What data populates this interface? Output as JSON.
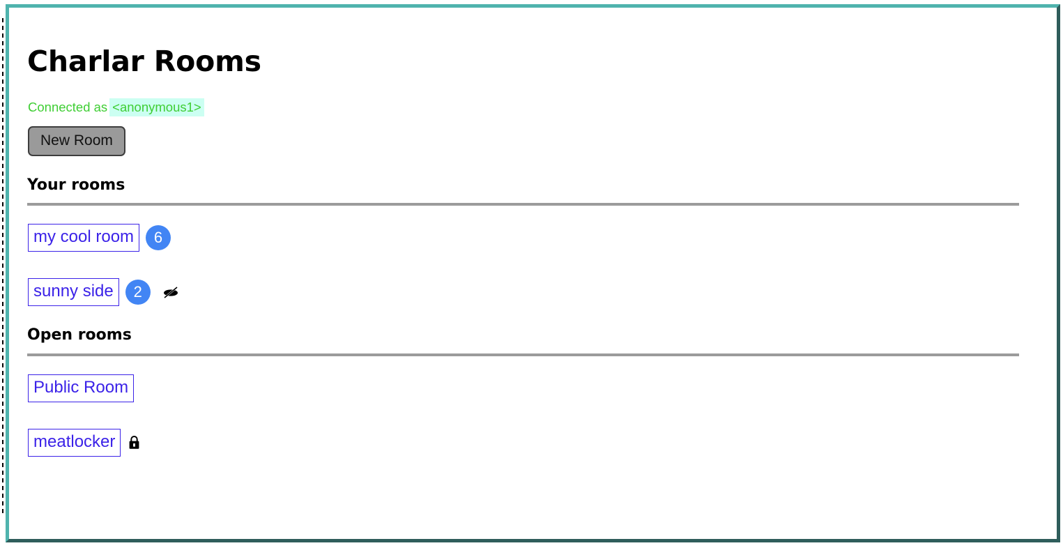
{
  "window": {
    "frame_accent_light": "#4fb3ad",
    "frame_accent_dark": "#2f5d5b"
  },
  "header": {
    "title": "Charlar Rooms",
    "connection_prefix": "Connected as",
    "username": "<anonymous1>",
    "status_color": "#3fce34",
    "username_highlight": "#ccfff2"
  },
  "toolbar": {
    "new_room_label": "New Room"
  },
  "sections": [
    {
      "heading": "Your rooms",
      "rooms": [
        {
          "name": "my cool room",
          "badge": "6",
          "icon": null
        },
        {
          "name": "sunny side",
          "badge": "2",
          "icon": "eye-slash-icon"
        }
      ]
    },
    {
      "heading": "Open rooms",
      "rooms": [
        {
          "name": "Public Room",
          "badge": null,
          "icon": null
        },
        {
          "name": "meatlocker",
          "badge": null,
          "icon": "lock-icon"
        }
      ]
    }
  ],
  "colors": {
    "link": "#3b22e8",
    "badge": "#4285f4",
    "button_face": "#9a9a9a",
    "rule": "#9b9b9b"
  }
}
